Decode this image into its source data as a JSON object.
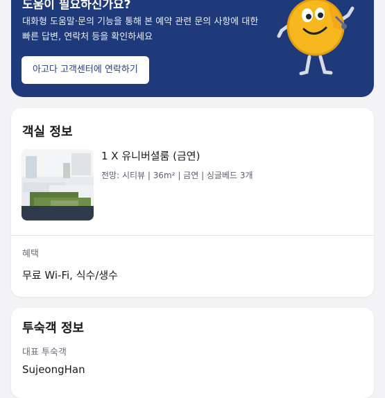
{
  "help_banner": {
    "title": "도움이 필요하신가요?",
    "description": "대화형 도움말·문의 기능을 통해 본 예약 관련 문의 사항에 대한 빠른 답변, 연락처 등을 확인하세요",
    "contact_button_label": "아고다 고객센터에 연락하기",
    "mascot": "agoda-mascot-illustration"
  },
  "room_info": {
    "section_title": "객실 정보",
    "room_name": "1 X 유니버셜룸 (금연)",
    "room_meta": "전망: 시티뷰 | 36m² | 금연 | 싱글베드 3개",
    "thumbnail": "room-photo",
    "benefits_label": "혜택",
    "benefits_value": "무료 Wi-Fi, 식수/생수"
  },
  "guest_info": {
    "section_title": "투숙객 정보",
    "lead_guest_label": "대표 투숙객",
    "lead_guest_name": "SujeongHan"
  },
  "colors": {
    "banner_bg": "#1f3a7a",
    "page_bg": "#f3f3f5",
    "card_bg": "#ffffff"
  }
}
